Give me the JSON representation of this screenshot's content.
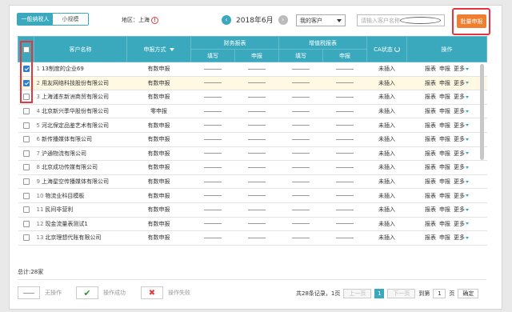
{
  "tabs": [
    {
      "label": "一般纳税人",
      "active": true
    },
    {
      "label": "小规模",
      "active": false
    }
  ],
  "region": {
    "label": "地区：上海"
  },
  "month": {
    "label": "2018年6月"
  },
  "client_select": {
    "value": "我的客户"
  },
  "search": {
    "placeholder": "请输入客户名称或助记码"
  },
  "batch_button": {
    "label": "批量申报"
  },
  "table": {
    "headers": {
      "name": "客户名称",
      "method": "申报方式",
      "financial": "财务报表",
      "vat": "增值税报表",
      "ca": "CA状态",
      "ops": "操作",
      "fill": "填写",
      "declare": "申报"
    },
    "rows": [
      {
        "num": "1",
        "name": "13制度的企业69",
        "method": "有数申报",
        "ca": "未插入",
        "checked": true,
        "highlight": false
      },
      {
        "num": "2",
        "name": "用友网络科技股份有限公司",
        "method": "有数申报",
        "ca": "未插入",
        "checked": true,
        "highlight": true
      },
      {
        "num": "3",
        "name": "上海浦东新洲商贸有限公司",
        "method": "有数申报",
        "ca": "未插入",
        "checked": false,
        "highlight": false
      },
      {
        "num": "4",
        "name": "北京新兴季华股份有限公司",
        "method": "零申报",
        "ca": "未插入",
        "checked": false,
        "highlight": false
      },
      {
        "num": "5",
        "name": "河北保定品鉴艺术有限公司",
        "method": "有数申报",
        "ca": "未插入",
        "checked": false,
        "highlight": false
      },
      {
        "num": "6",
        "name": "新传播媒体有限公司",
        "method": "有数申报",
        "ca": "未插入",
        "checked": false,
        "highlight": false
      },
      {
        "num": "7",
        "name": "沪通物流有限公司",
        "method": "有数申报",
        "ca": "未插入",
        "checked": false,
        "highlight": false
      },
      {
        "num": "8",
        "name": "北京成功传媒有限公司",
        "method": "有数申报",
        "ca": "未插入",
        "checked": false,
        "highlight": false
      },
      {
        "num": "9",
        "name": "上海星空传播媒体有限公司",
        "method": "有数申报",
        "ca": "未插入",
        "checked": false,
        "highlight": false
      },
      {
        "num": "10",
        "name": "物流业科目模板",
        "method": "有数申报",
        "ca": "未插入",
        "checked": false,
        "highlight": false
      },
      {
        "num": "11",
        "name": "民间非营利",
        "method": "有数申报",
        "ca": "未插入",
        "checked": false,
        "highlight": false
      },
      {
        "num": "12",
        "name": "现金流量表测试1",
        "method": "有数申报",
        "ca": "未插入",
        "checked": false,
        "highlight": false
      },
      {
        "num": "13",
        "name": "北京理想代账有限公司",
        "method": "有数申报",
        "ca": "未插入",
        "checked": false,
        "highlight": false
      }
    ],
    "op_labels": {
      "report": "报表",
      "declare": "申报",
      "more": "更多"
    }
  },
  "total": {
    "label": "总计:28家"
  },
  "legend": [
    {
      "label": "无操作",
      "icon": "dash-icon"
    },
    {
      "label": "操作成功",
      "icon": "check-icon"
    },
    {
      "label": "操作失败",
      "icon": "x-icon"
    }
  ],
  "pagination": {
    "summary": "共28条记录，1页",
    "prev": "上一页",
    "current": "1",
    "next": "下一页",
    "goto": "到第",
    "goto_value": "1",
    "page_unit": "页",
    "confirm": "确定"
  },
  "colors": {
    "accent": "#3aa9bd",
    "batch": "#f17d2e",
    "highlight_border": "#e8343c"
  }
}
